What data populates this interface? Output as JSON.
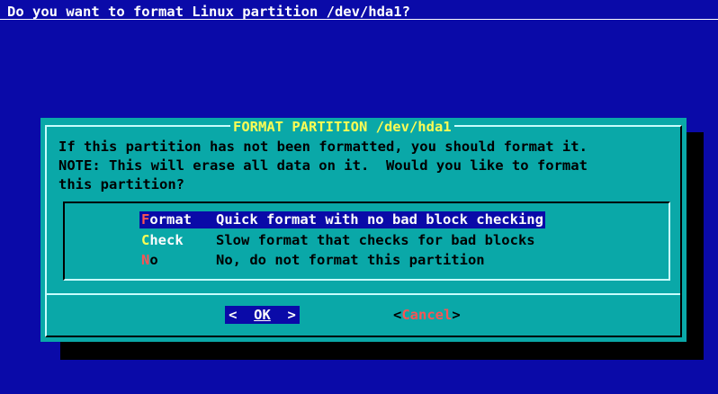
{
  "backtitle": "Do you want to format Linux partition /dev/hda1?",
  "dialog": {
    "title": "FORMAT PARTITION /dev/hda1",
    "message": "If this partition has not been formatted, you should format it.\nNOTE: This will erase all data on it.  Would you like to format\nthis partition?",
    "menu": [
      {
        "tag_first": "F",
        "tag_rest": "ormat",
        "desc": "Quick format with no bad block checking",
        "selected": true
      },
      {
        "tag_first": "C",
        "tag_rest": "heck",
        "desc": "Slow format that checks for bad blocks",
        "selected": false
      },
      {
        "tag_first": "N",
        "tag_rest": "o",
        "desc": "No, do not format this partition",
        "selected": false
      }
    ],
    "buttons": {
      "ok": {
        "left": "<  ",
        "hot": "OK",
        "right": "  >"
      },
      "cancel": {
        "left": "<",
        "hot": "Cancel",
        "right": ">"
      }
    }
  },
  "colors": {
    "background": "#0a0aa8",
    "dialog": "#0aa8a8",
    "title": "#fcfc54",
    "hotkey": "#fc5454",
    "highlight": "#0a0aa8"
  }
}
